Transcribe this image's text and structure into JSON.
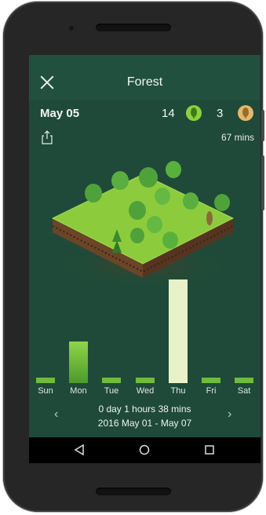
{
  "header": {
    "title": "Forest"
  },
  "stats": {
    "date": "May 05",
    "trees_count": "14",
    "dead_trees_count": "3",
    "total_time": "67 mins"
  },
  "chart_data": {
    "type": "bar",
    "categories": [
      "Sun",
      "Mon",
      "Tue",
      "Wed",
      "Thu",
      "Fri",
      "Sat"
    ],
    "values": [
      5,
      40,
      5,
      5,
      100,
      5,
      5
    ],
    "highlight_index": 4,
    "colors": {
      "bar": "#6fbb3b",
      "highlight": "#e9f1c8"
    }
  },
  "summary": {
    "duration": "0 day 1 hours 38 mins",
    "range": "2016 May 01 - May 07"
  },
  "colors": {
    "background": "#1f4a39",
    "topbar": "#22503e",
    "accent_green": "#8dd13a",
    "accent_tan": "#e2b86a"
  },
  "icons": {
    "close": "close-icon",
    "tree": "tree-badge-icon",
    "dead_tree": "dead-tree-badge-icon",
    "share": "share-icon"
  }
}
